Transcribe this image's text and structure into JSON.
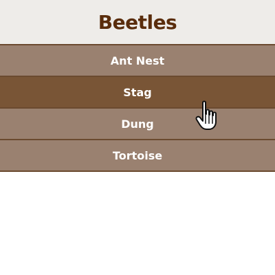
{
  "header": {
    "title": "Beetles"
  },
  "menu": {
    "items": [
      {
        "label": "Ant Nest",
        "active": false
      },
      {
        "label": "Stag",
        "active": true
      },
      {
        "label": "Dung",
        "active": false
      },
      {
        "label": "Tortoise",
        "active": false
      }
    ]
  },
  "colors": {
    "title": "#5a2d0c",
    "header_bg": "#eeece9",
    "item_bg": "#9a8170",
    "item_active_bg": "#795536",
    "divider": "#6b4a2f"
  },
  "cursor": {
    "icon": "hand-pointer-icon"
  }
}
